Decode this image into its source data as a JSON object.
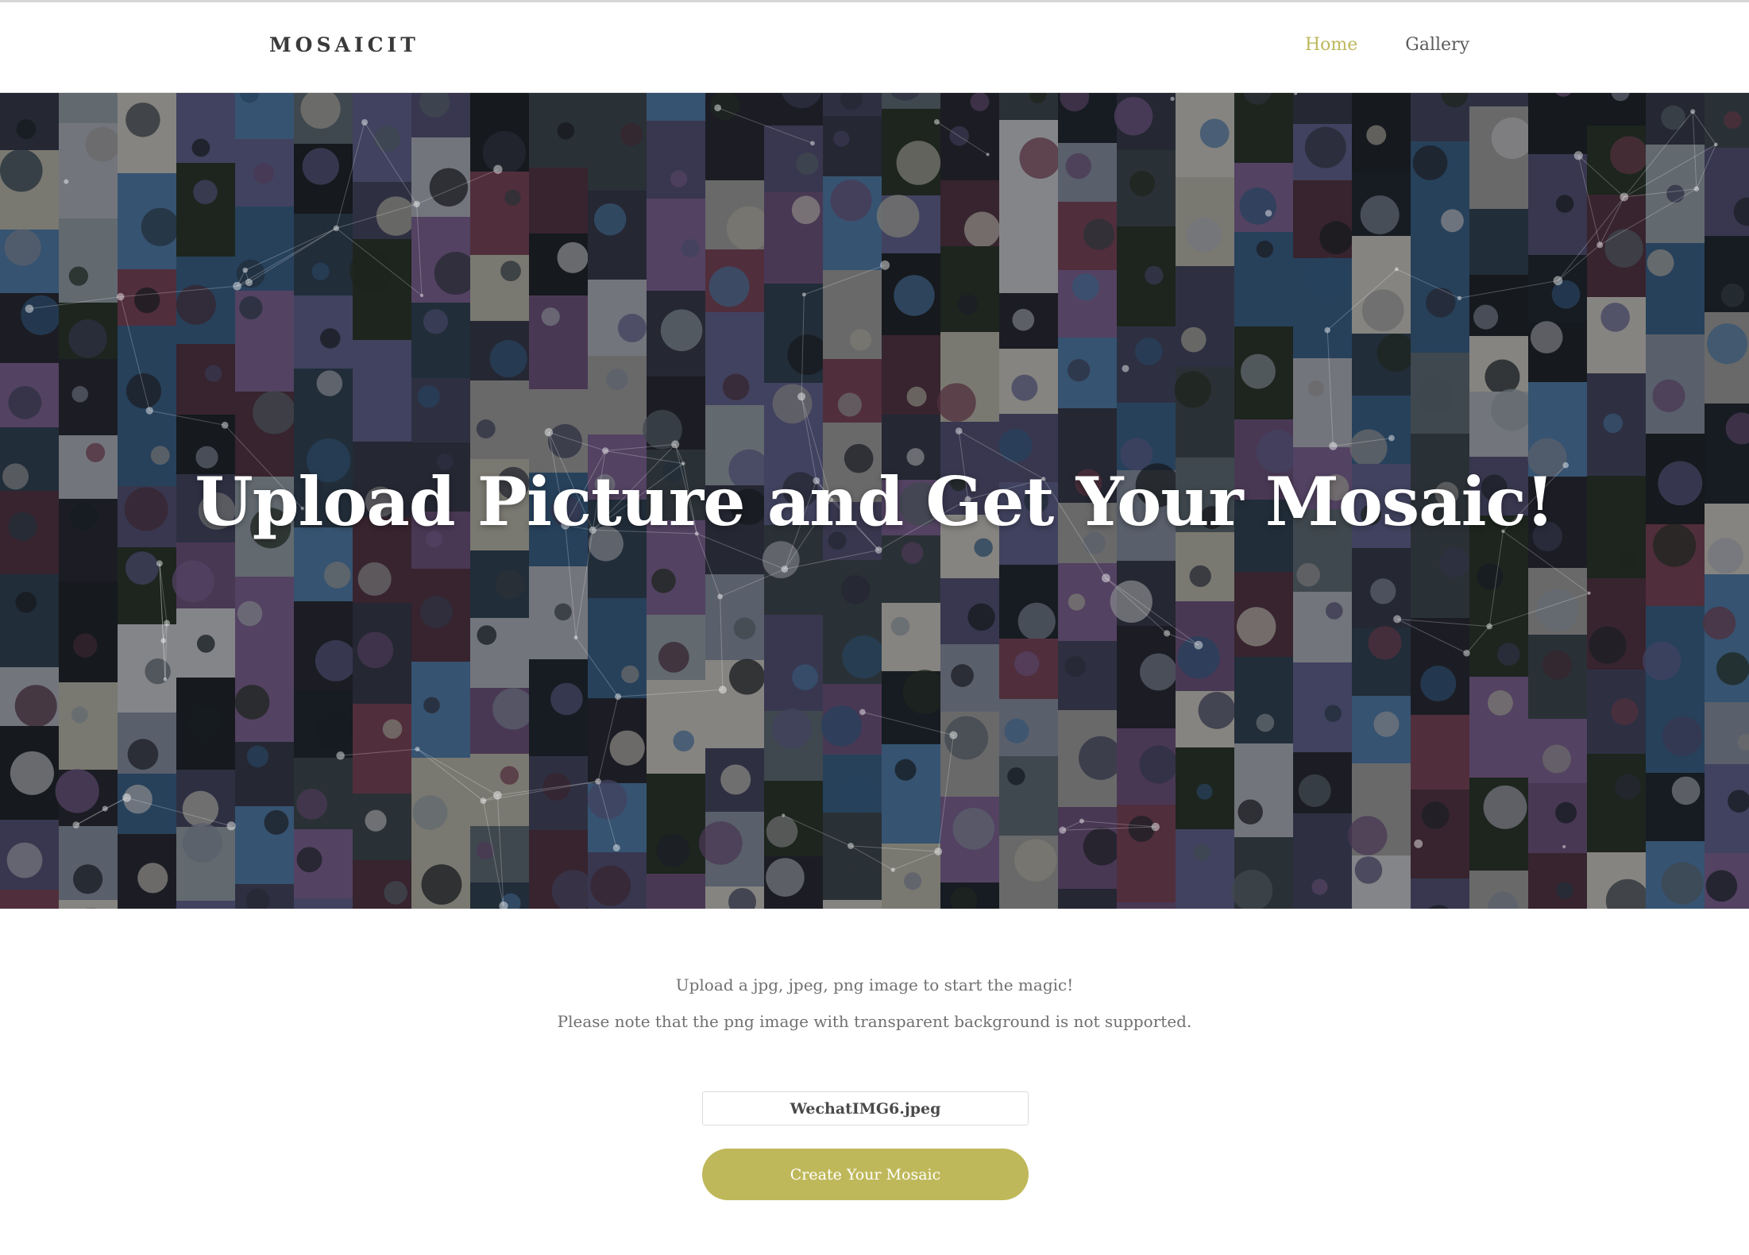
{
  "nav": {
    "brand": "MOSAICIT",
    "links": [
      {
        "label": "Home",
        "active": true
      },
      {
        "label": "Gallery",
        "active": false
      }
    ]
  },
  "hero": {
    "title": "Upload Picture and Get Your Mosaic!"
  },
  "upload": {
    "note_1": "Upload a jpg, jpeg, png image to start the magic!",
    "note_2": "Please note that the png image with transparent background is not supported.",
    "file_name": "WechatIMG6.jpeg",
    "button_label": "Create Your Mosaic"
  },
  "colors": {
    "accent": "#bfb85a",
    "nav_active": "#bdb85d",
    "text_muted": "#707070"
  }
}
